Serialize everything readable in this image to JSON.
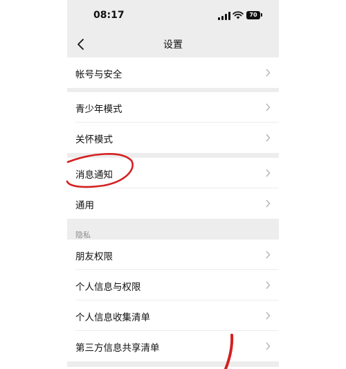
{
  "status_bar": {
    "time": "08:17",
    "battery": "70",
    "icons": [
      "signal-icon",
      "wifi-icon",
      "battery-icon"
    ]
  },
  "nav": {
    "title": "设置",
    "back_icon": "chevron-left-icon"
  },
  "groups": [
    {
      "items": [
        {
          "label": "帐号与安全"
        }
      ]
    },
    {
      "items": [
        {
          "label": "青少年模式"
        },
        {
          "label": "关怀模式"
        }
      ]
    },
    {
      "items": [
        {
          "label": "消息通知"
        },
        {
          "label": "通用"
        }
      ]
    },
    {
      "header": "隐私",
      "items": [
        {
          "label": "朋友权限"
        },
        {
          "label": "个人信息与权限"
        },
        {
          "label": "个人信息收集清单"
        },
        {
          "label": "第三方信息共享清单"
        }
      ]
    }
  ],
  "colors": {
    "background": "#ededed",
    "cell": "#ffffff",
    "annotation": "#d42020"
  }
}
